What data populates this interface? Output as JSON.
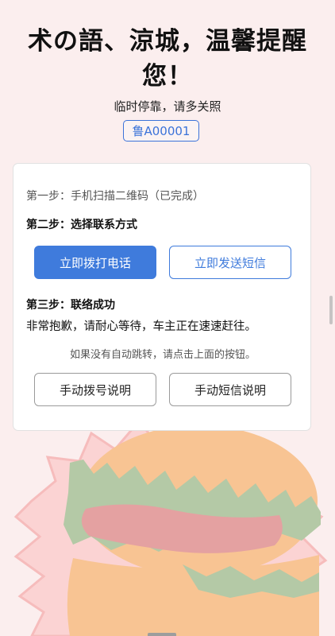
{
  "header": {
    "title": "术の語、涼城，温馨提醒您！",
    "subtitle": "临时停靠，请多关照",
    "plate": "鲁A00001"
  },
  "card": {
    "step1": "第一步：手机扫描二维码（已完成）",
    "step2": "第二步：选择联系方式",
    "call_button": "立即拨打电话",
    "sms_button": "立即发送短信",
    "step3": "第三步：联络成功",
    "message": "非常抱歉，请耐心等待，车主正在速速赶往。",
    "hint": "如果没有自动跳转，请点击上面的按钮。",
    "call_help_button": "手动拨号说明",
    "sms_help_button": "手动短信说明"
  },
  "colors": {
    "accent": "#3f7bdc",
    "background": "#fbeeee"
  },
  "illustration": "burger-illustration"
}
